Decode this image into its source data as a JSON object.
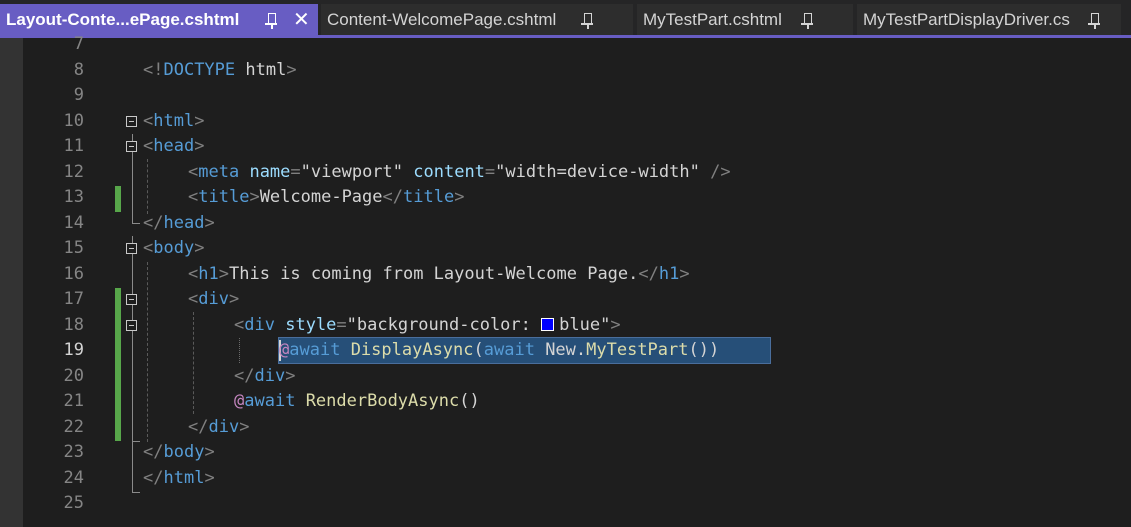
{
  "tabs": [
    {
      "label": "Layout-Conte...ePage.cshtml",
      "active": true
    },
    {
      "label": "Content-WelcomePage.cshtml",
      "active": false
    },
    {
      "label": "MyTestPart.cshtml",
      "active": false
    },
    {
      "label": "MyTestPartDisplayDriver.cs",
      "active": false
    }
  ],
  "close_glyph": "✕",
  "colors": {
    "accent": "#685dc3",
    "change_bar": "#57a64a",
    "selection": "#264f78",
    "swatch_blue": "#0000ff"
  },
  "editor": {
    "current_line": "19",
    "lines": [
      {
        "num": "7",
        "tokens": []
      },
      {
        "num": "8",
        "tokens": [
          [
            "c-bracket",
            "<!"
          ],
          [
            "c-tag",
            "DOCTYPE"
          ],
          [
            "c-text",
            " html"
          ],
          [
            "c-bracket",
            ">"
          ]
        ]
      },
      {
        "num": "9",
        "tokens": []
      },
      {
        "num": "10",
        "tokens": [
          [
            "c-bracket",
            "<"
          ],
          [
            "c-tag",
            "html"
          ],
          [
            "c-bracket",
            ">"
          ]
        ]
      },
      {
        "num": "11",
        "tokens": [
          [
            "c-bracket",
            "<"
          ],
          [
            "c-tag",
            "head"
          ],
          [
            "c-bracket",
            ">"
          ]
        ]
      },
      {
        "num": "12",
        "tokens": [
          [
            "c-bracket",
            "<"
          ],
          [
            "c-tag",
            "meta"
          ],
          [
            "c-text",
            " "
          ],
          [
            "c-attr",
            "name"
          ],
          [
            "c-bracket",
            "="
          ],
          [
            "c-str",
            "\"viewport\""
          ],
          [
            "c-text",
            " "
          ],
          [
            "c-attr",
            "content"
          ],
          [
            "c-bracket",
            "="
          ],
          [
            "c-str",
            "\"width=device-width\""
          ],
          [
            "c-text",
            " "
          ],
          [
            "c-bracket",
            "/>"
          ]
        ]
      },
      {
        "num": "13",
        "tokens": [
          [
            "c-bracket",
            "<"
          ],
          [
            "c-tag",
            "title"
          ],
          [
            "c-bracket",
            ">"
          ],
          [
            "c-text",
            "Welcome-Page"
          ],
          [
            "c-bracket",
            "</"
          ],
          [
            "c-tag",
            "title"
          ],
          [
            "c-bracket",
            ">"
          ]
        ]
      },
      {
        "num": "14",
        "tokens": [
          [
            "c-bracket",
            "</"
          ],
          [
            "c-tag",
            "head"
          ],
          [
            "c-bracket",
            ">"
          ]
        ]
      },
      {
        "num": "15",
        "tokens": [
          [
            "c-bracket",
            "<"
          ],
          [
            "c-tag",
            "body"
          ],
          [
            "c-bracket",
            ">"
          ]
        ]
      },
      {
        "num": "16",
        "tokens": [
          [
            "c-bracket",
            "<"
          ],
          [
            "c-tag",
            "h1"
          ],
          [
            "c-bracket",
            ">"
          ],
          [
            "c-text",
            "This is coming from Layout-Welcome Page."
          ],
          [
            "c-bracket",
            "</"
          ],
          [
            "c-tag",
            "h1"
          ],
          [
            "c-bracket",
            ">"
          ]
        ]
      },
      {
        "num": "17",
        "tokens": [
          [
            "c-bracket",
            "<"
          ],
          [
            "c-tag",
            "div"
          ],
          [
            "c-bracket",
            ">"
          ]
        ]
      },
      {
        "num": "18",
        "tokens": [
          [
            "c-bracket",
            "<"
          ],
          [
            "c-tag",
            "div"
          ],
          [
            "c-text",
            " "
          ],
          [
            "c-attr",
            "style"
          ],
          [
            "c-bracket",
            "="
          ],
          [
            "c-str",
            "\"background-color: "
          ],
          [
            "swatch",
            ""
          ],
          [
            "c-str",
            "blue\""
          ],
          [
            "c-bracket",
            ">"
          ]
        ]
      },
      {
        "num": "19",
        "tokens": [
          [
            "c-razor",
            "@"
          ],
          [
            "c-kw",
            "await"
          ],
          [
            "c-text",
            " "
          ],
          [
            "c-method",
            "DisplayAsync"
          ],
          [
            "c-text",
            "("
          ],
          [
            "c-kw",
            "await"
          ],
          [
            "c-text",
            " New."
          ],
          [
            "c-member",
            "MyTestPart"
          ],
          [
            "c-text",
            "())"
          ]
        ]
      },
      {
        "num": "20",
        "tokens": [
          [
            "c-bracket",
            "</"
          ],
          [
            "c-tag",
            "div"
          ],
          [
            "c-bracket",
            ">"
          ]
        ]
      },
      {
        "num": "21",
        "tokens": [
          [
            "c-razor",
            "@"
          ],
          [
            "c-kw",
            "await"
          ],
          [
            "c-text",
            " "
          ],
          [
            "c-method",
            "RenderBodyAsync"
          ],
          [
            "c-text",
            "()"
          ]
        ]
      },
      {
        "num": "22",
        "tokens": [
          [
            "c-bracket",
            "</"
          ],
          [
            "c-tag",
            "div"
          ],
          [
            "c-bracket",
            ">"
          ]
        ]
      },
      {
        "num": "23",
        "tokens": [
          [
            "c-bracket",
            "</"
          ],
          [
            "c-tag",
            "body"
          ],
          [
            "c-bracket",
            ">"
          ]
        ]
      },
      {
        "num": "24",
        "tokens": [
          [
            "c-bracket",
            "</"
          ],
          [
            "c-tag",
            "html"
          ],
          [
            "c-bracket",
            ">"
          ]
        ]
      },
      {
        "num": "25",
        "tokens": []
      }
    ]
  }
}
